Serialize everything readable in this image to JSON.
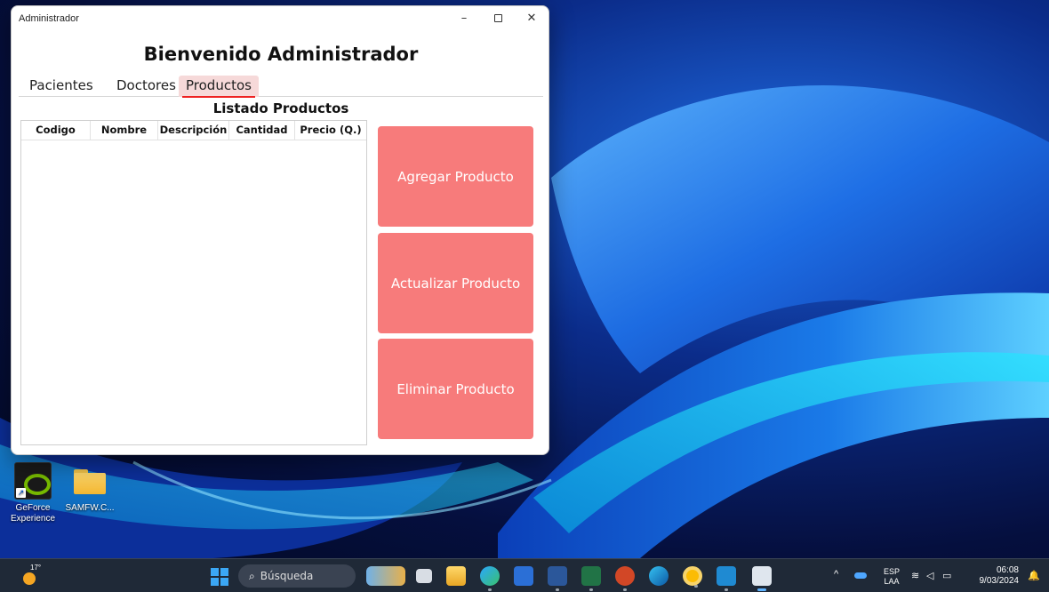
{
  "window": {
    "title": "Administrador",
    "minimize": "–",
    "close": "✕"
  },
  "header": {
    "title": "Bienvenido Administrador"
  },
  "tabs": [
    {
      "label": "Pacientes",
      "active": false
    },
    {
      "label": "Doctores",
      "active": false
    },
    {
      "label": "Productos",
      "active": true
    }
  ],
  "products": {
    "title": "Listado Productos",
    "columns": [
      "Codigo",
      "Nombre",
      "Descripción",
      "Cantidad",
      "Precio (Q.)"
    ],
    "rows": []
  },
  "actions": {
    "add": "Agregar Producto",
    "update": "Actualizar Producto",
    "delete": "Eliminar Producto",
    "color": "#f77b7b"
  },
  "desktop": {
    "icons": [
      {
        "label": "GeForce Experience",
        "icon": "geforce-icon"
      },
      {
        "label": "SAMFW.C...",
        "icon": "folder-icon"
      }
    ]
  },
  "taskbar": {
    "weather_temp": "17°",
    "search_placeholder": "Búsqueda",
    "lang_line1": "ESP",
    "lang_line2": "LAA",
    "time": "06:08",
    "date": "9/03/2024"
  }
}
